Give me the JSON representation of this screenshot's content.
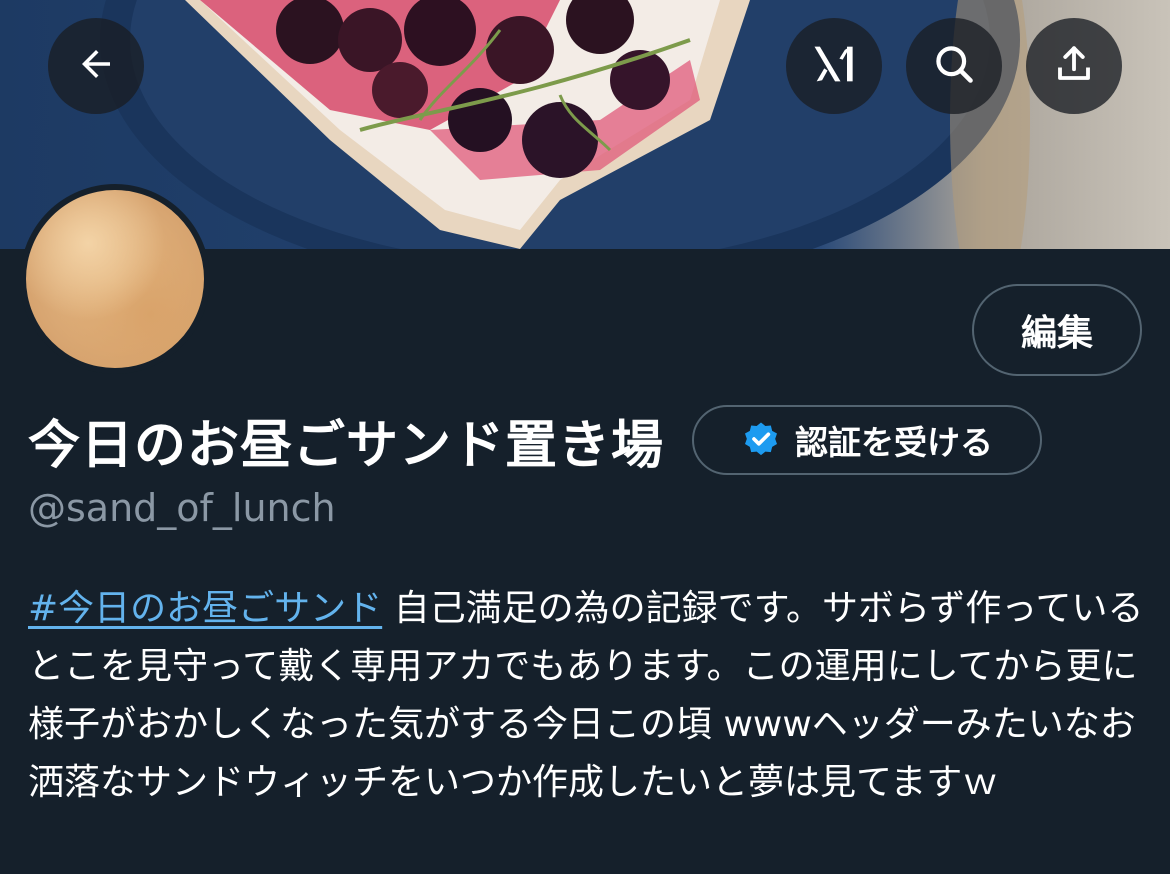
{
  "header": {
    "back_icon": "arrow-left-icon",
    "grok_icon": "grok-icon",
    "search_icon": "search-icon",
    "share_icon": "share-icon"
  },
  "profile": {
    "edit_label": "編集",
    "display_name": "今日のお昼ごサンド置き場",
    "verify_label": "認証を受ける",
    "handle": "@sand_of_lunch",
    "bio_hashtag": "#今日のお昼ごサンド",
    "bio_text": " 自己満足の為の記録です。サボらず作っているとこを見守って戴く専用アカでもあります。この運用にしてから更に様子がおかしくなった気がする今日この頃 wwwヘッダーみたいなお洒落なサンドウィッチをいつか作成したいと夢は見てますｗ"
  },
  "colors": {
    "background": "#15202b",
    "border": "#536471",
    "muted_text": "#8b98a5",
    "link": "#63b3ed",
    "verified_blue": "#1d9bf0"
  }
}
